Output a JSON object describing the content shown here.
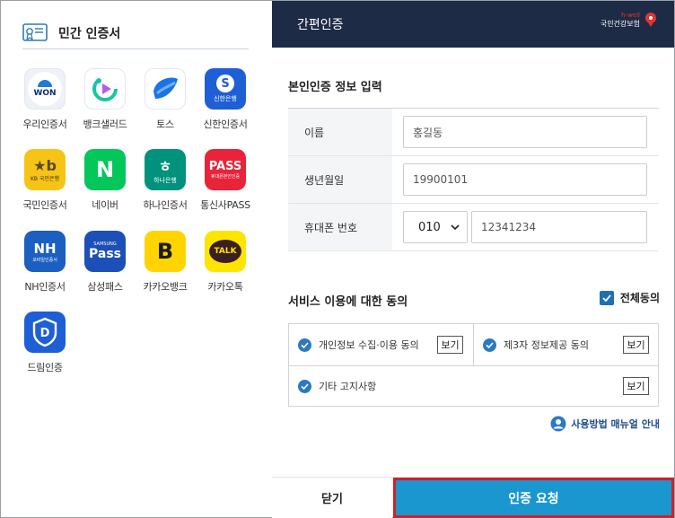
{
  "left": {
    "title": "민간 인증서",
    "apps": [
      {
        "label": "우리인증서",
        "icon": "woori-icon",
        "badge": "WON"
      },
      {
        "label": "뱅크샐러드",
        "icon": "banksalad-icon",
        "badge": ""
      },
      {
        "label": "토스",
        "icon": "toss-icon",
        "badge": ""
      },
      {
        "label": "신한인증서",
        "icon": "shinhan-icon",
        "badge": "신한은행"
      },
      {
        "label": "국민인증서",
        "icon": "kb-icon",
        "badge": "KB 국민은행"
      },
      {
        "label": "네이버",
        "icon": "naver-icon",
        "badge": "N"
      },
      {
        "label": "하나인증서",
        "icon": "hana-icon",
        "badge": "하나은행"
      },
      {
        "label": "통신사PASS",
        "icon": "pass-icon",
        "badge": "PASS",
        "sub": "휴대폰본인인증"
      },
      {
        "label": "NH인증서",
        "icon": "nh-icon",
        "badge": "NH",
        "sub": "모바일인증서"
      },
      {
        "label": "삼성패스",
        "icon": "samsung-pass-icon",
        "badge": "Pass",
        "sub": "SAMSUNG"
      },
      {
        "label": "카카오뱅크",
        "icon": "kakaobank-icon",
        "badge": "B"
      },
      {
        "label": "카카오톡",
        "icon": "kakaotalk-icon",
        "badge": "TALK"
      },
      {
        "label": "드림인증",
        "icon": "dream-icon",
        "badge": "D"
      }
    ]
  },
  "right": {
    "header_title": "간편인증",
    "logo_top": "h-well",
    "logo_text": "국민건강보험",
    "section_title": "본인인증 정보 입력",
    "form": {
      "name_label": "이름",
      "name_placeholder": "홍길동",
      "birth_label": "생년월일",
      "birth_placeholder": "19900101",
      "phone_label": "휴대폰 번호",
      "phone_prefix": "010",
      "phone_placeholder": "12341234"
    },
    "agree_title": "서비스 이용에 대한 동의",
    "agree_all": "전체동의",
    "agree_items": [
      {
        "label": "개인정보 수집·이용 동의",
        "view": "보기"
      },
      {
        "label": "제3자 정보제공 동의",
        "view": "보기"
      },
      {
        "label": "기타 고지사항",
        "view": "보기"
      }
    ],
    "guide_link": "사용방법 매뉴얼 안내",
    "close_button": "닫기",
    "request_button": "인증 요청"
  },
  "colors": {
    "header_bg": "#1e2b47",
    "request_bg": "#1a97cf",
    "highlight_border": "#d0202a",
    "check_blue": "#2b79c2"
  }
}
